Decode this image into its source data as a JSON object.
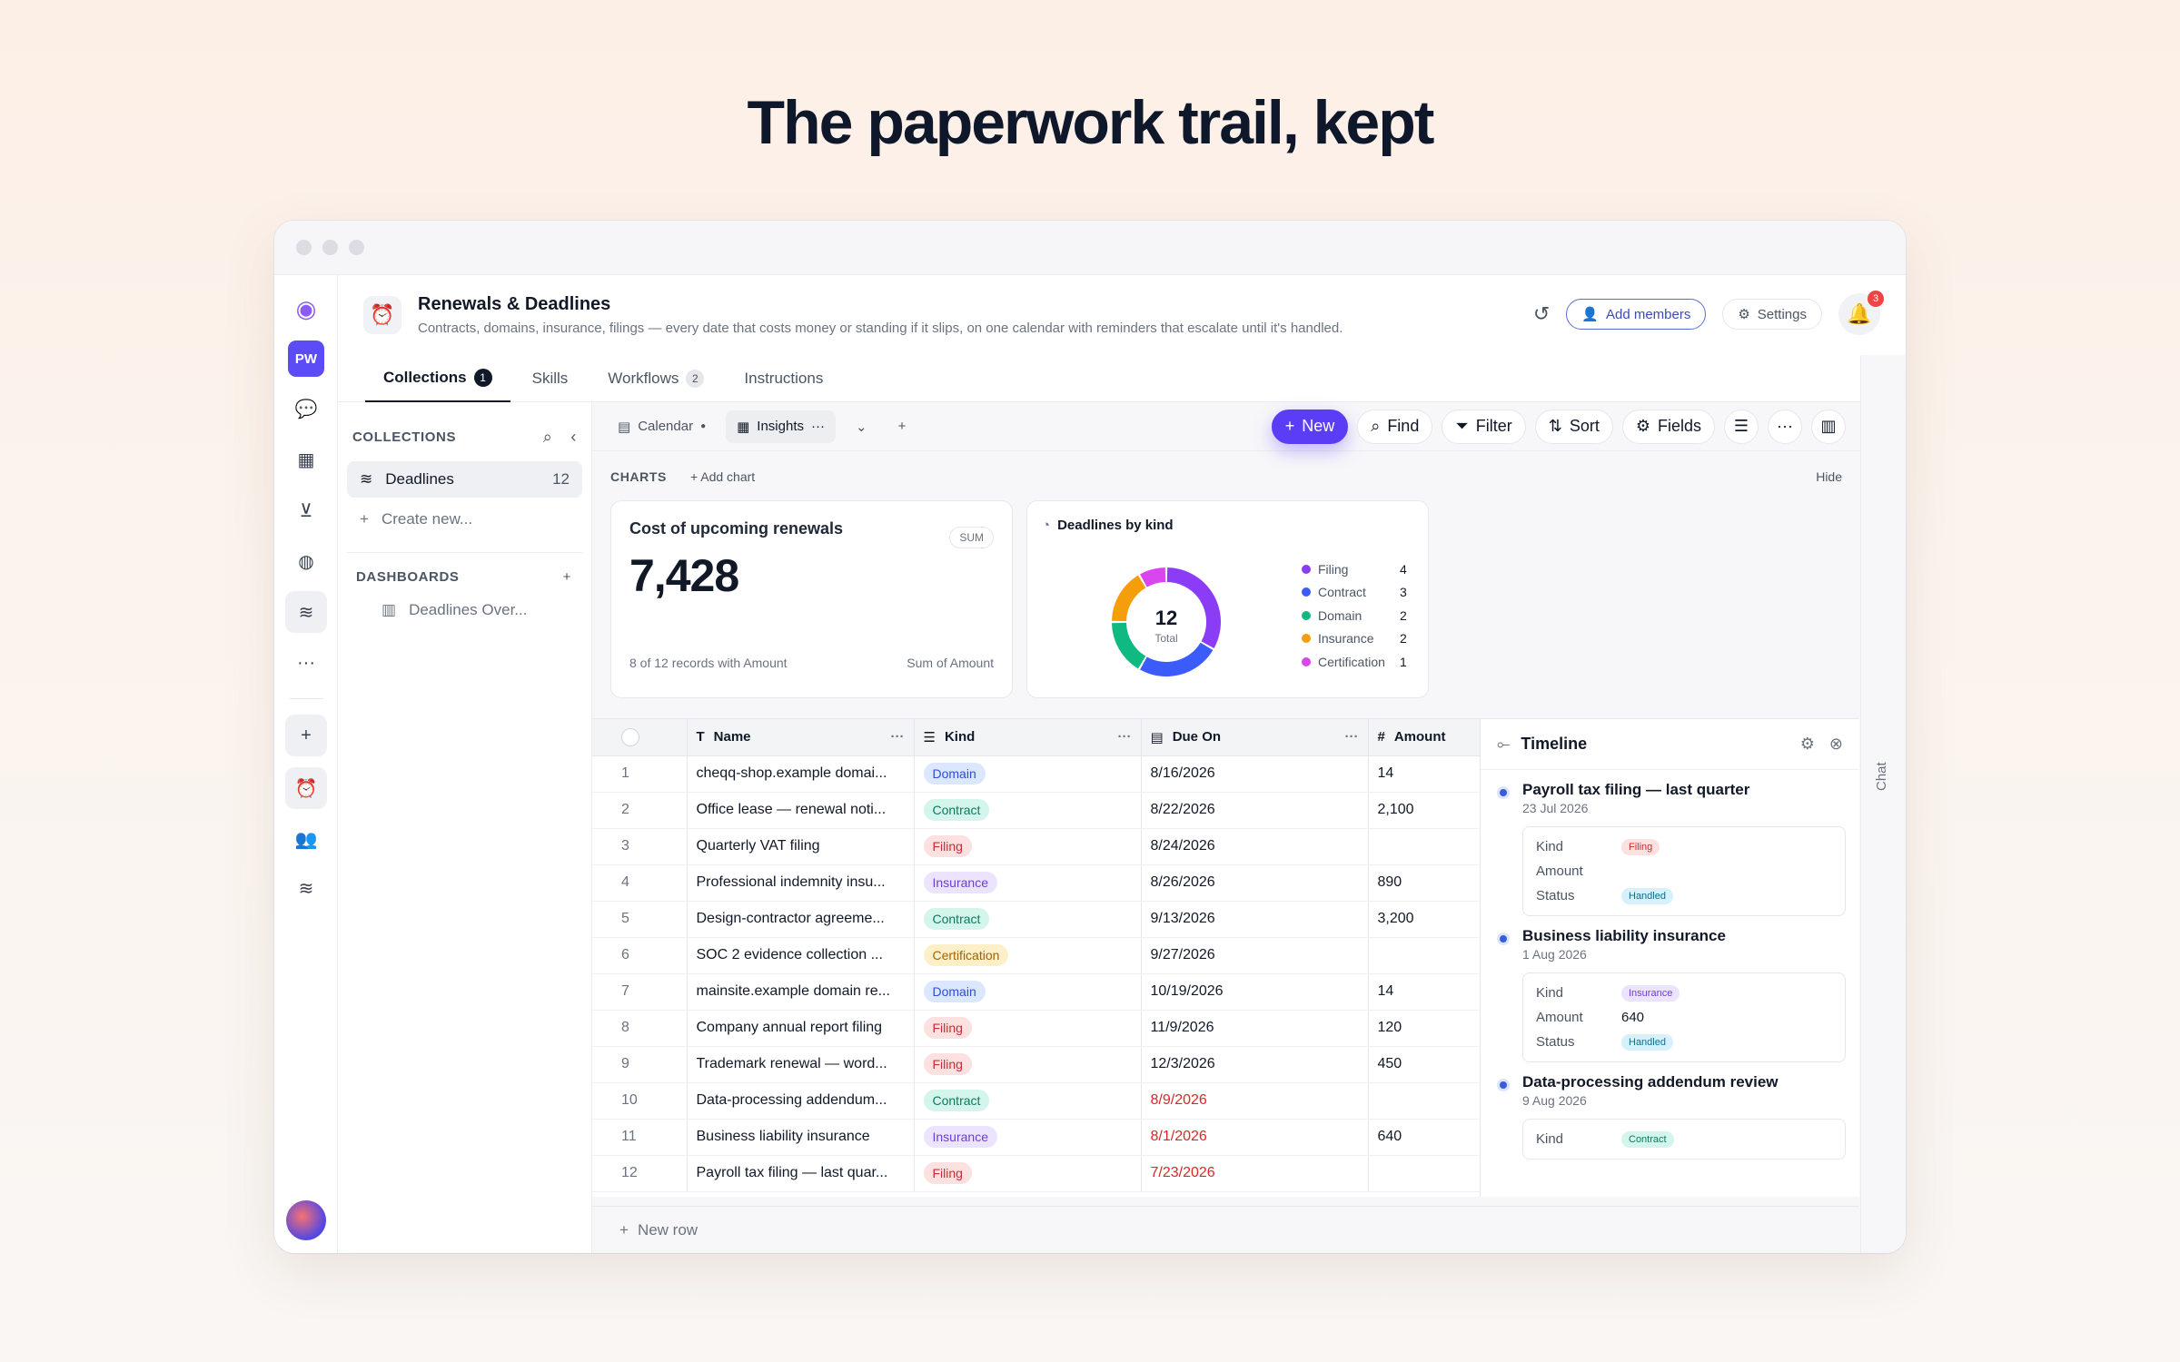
{
  "hero": {
    "title": "The paperwork trail, kept"
  },
  "header": {
    "title": "Renewals & Deadlines",
    "description": "Contracts, domains, insurance, filings — every date that costs money or standing if it slips, on one calendar with reminders that escalate until it's handled.",
    "add_members": "Add members",
    "settings": "Settings",
    "notifications": "3"
  },
  "rail": {
    "workspace": "PW"
  },
  "tabs": [
    {
      "label": "Collections",
      "count": "1"
    },
    {
      "label": "Skills"
    },
    {
      "label": "Workflows",
      "count": "2"
    },
    {
      "label": "Instructions"
    }
  ],
  "sidebar": {
    "collections_heading": "COLLECTIONS",
    "item_label": "Deadlines",
    "item_count": "12",
    "create_new": "Create new...",
    "dashboards_heading": "DASHBOARDS",
    "dashboard_item": "Deadlines Over..."
  },
  "toolbar": {
    "view_calendar": "Calendar",
    "view_insights": "Insights",
    "new": "New",
    "find": "Find",
    "filter": "Filter",
    "sort": "Sort",
    "fields": "Fields"
  },
  "charts": {
    "heading": "CHARTS",
    "add": "Add chart",
    "hide": "Hide",
    "card1": {
      "title": "Cost of upcoming renewals",
      "pill": "SUM",
      "value": "7,428",
      "foot_left": "8 of 12 records with Amount",
      "foot_right": "Sum of Amount"
    },
    "card2": {
      "title": "Deadlines by kind",
      "total": "12",
      "total_label": "Total"
    }
  },
  "chart_data": {
    "type": "pie",
    "title": "Deadlines by kind",
    "categories": [
      "Filing",
      "Contract",
      "Domain",
      "Insurance",
      "Certification"
    ],
    "values": [
      4,
      3,
      2,
      2,
      1
    ],
    "colors": [
      "#8b3cf6",
      "#3b5bfa",
      "#10b981",
      "#f59e0b",
      "#d946ef"
    ],
    "total": 12
  },
  "table": {
    "columns": [
      "Name",
      "Kind",
      "Due On",
      "Amount"
    ],
    "rows": [
      {
        "n": "1",
        "name": "cheqq-shop.example domai...",
        "kind": "Domain",
        "due": "8/16/2026",
        "amount": "14",
        "overdue": false
      },
      {
        "n": "2",
        "name": "Office lease — renewal noti...",
        "kind": "Contract",
        "due": "8/22/2026",
        "amount": "2,100",
        "overdue": false
      },
      {
        "n": "3",
        "name": "Quarterly VAT filing",
        "kind": "Filing",
        "due": "8/24/2026",
        "amount": "",
        "overdue": false
      },
      {
        "n": "4",
        "name": "Professional indemnity insu...",
        "kind": "Insurance",
        "due": "8/26/2026",
        "amount": "890",
        "overdue": false
      },
      {
        "n": "5",
        "name": "Design-contractor agreeme...",
        "kind": "Contract",
        "due": "9/13/2026",
        "amount": "3,200",
        "overdue": false
      },
      {
        "n": "6",
        "name": "SOC 2 evidence collection ...",
        "kind": "Certification",
        "due": "9/27/2026",
        "amount": "",
        "overdue": false
      },
      {
        "n": "7",
        "name": "mainsite.example domain re...",
        "kind": "Domain",
        "due": "10/19/2026",
        "amount": "14",
        "overdue": false
      },
      {
        "n": "8",
        "name": "Company annual report filing",
        "kind": "Filing",
        "due": "11/9/2026",
        "amount": "120",
        "overdue": false
      },
      {
        "n": "9",
        "name": "Trademark renewal — word...",
        "kind": "Filing",
        "due": "12/3/2026",
        "amount": "450",
        "overdue": false
      },
      {
        "n": "10",
        "name": "Data-processing addendum...",
        "kind": "Contract",
        "due": "8/9/2026",
        "amount": "",
        "overdue": true
      },
      {
        "n": "11",
        "name": "Business liability insurance",
        "kind": "Insurance",
        "due": "8/1/2026",
        "amount": "640",
        "overdue": true
      },
      {
        "n": "12",
        "name": "Payroll tax filing — last quar...",
        "kind": "Filing",
        "due": "7/23/2026",
        "amount": "",
        "overdue": true
      }
    ],
    "new_row": "New row"
  },
  "kind_colors": {
    "Domain": {
      "bg": "#dbe6ff",
      "fg": "#2f4fd8"
    },
    "Contract": {
      "bg": "#d4f5ec",
      "fg": "#0f7a5c"
    },
    "Filing": {
      "bg": "#fde0e0",
      "fg": "#c53030"
    },
    "Insurance": {
      "bg": "#ece4ff",
      "fg": "#6b3fd1"
    },
    "Certification": {
      "bg": "#fdf0c8",
      "fg": "#a16207"
    },
    "Handled": {
      "bg": "#d6f1fb",
      "fg": "#0e6e8c"
    }
  },
  "timeline": {
    "title": "Timeline",
    "entries": [
      {
        "title": "Payroll tax filing — last quarter",
        "date": "23 Jul 2026",
        "kind": "Filing",
        "amount": "",
        "status": "Handled"
      },
      {
        "title": "Business liability insurance",
        "date": "1 Aug 2026",
        "kind": "Insurance",
        "amount": "640",
        "status": "Handled"
      },
      {
        "title": "Data-processing addendum review",
        "date": "9 Aug 2026",
        "kind": "Contract",
        "amount": "",
        "status": ""
      }
    ],
    "labels": {
      "kind": "Kind",
      "amount": "Amount",
      "status": "Status"
    }
  },
  "chat_label": "Chat"
}
